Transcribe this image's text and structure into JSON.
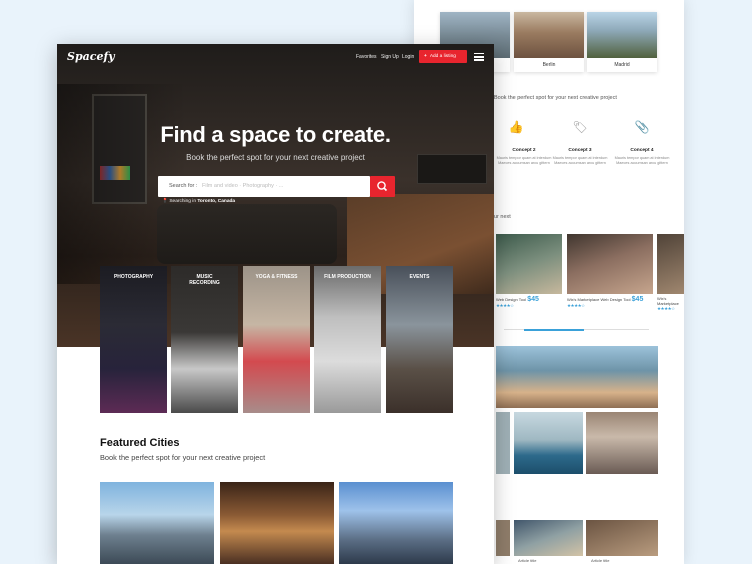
{
  "colors": {
    "accent": "#e8252e",
    "blue": "#3aa1d9",
    "bg": "#e9f3fb"
  },
  "back": {
    "cities": [
      {
        "label": ""
      },
      {
        "label": "Berlin"
      },
      {
        "label": "Madrid"
      }
    ],
    "tagline": "Book the perfect spot for your next creative project",
    "concepts": [
      {
        "icon": "thumbs-up-icon",
        "glyph": "👍",
        "title": "",
        "desc": ""
      },
      {
        "icon": "tag-icon",
        "glyph": "🏷",
        "title": "Concept 2",
        "desc": "Mauris tempor quam at interdum Maeces accumsan arcu gittern"
      },
      {
        "icon": "tag-icon",
        "glyph": "🏷",
        "title": "Concept 3",
        "desc": "Mauris tempor quam at interdum Maeces accumsan arcu gittern"
      },
      {
        "icon": "paperclip-icon",
        "glyph": "📎",
        "title": "Concept 4",
        "desc": "Mauris tempor quam at interdum Maeces accumsan arcu gittern"
      }
    ],
    "next_label": "ur next",
    "listings": [
      {
        "title": "Web Design Tool",
        "price": "$45",
        "unit": "BY DAY"
      },
      {
        "title": "Wix's Marketplace Web Design Tool",
        "price": "$45",
        "unit": "BY DAY"
      },
      {
        "title": "Wix's Marketplace",
        "price": "",
        "unit": ""
      }
    ],
    "rating": 4,
    "bottom_labels": [
      "Article title",
      "Article title"
    ]
  },
  "front": {
    "logo": "Spacefy",
    "nav": {
      "favorites": "Favorites",
      "signup": "Sign Up",
      "login": "Login",
      "add_listing": "Add a listing",
      "plus": "+"
    },
    "hero": {
      "title": "Find a space to create.",
      "subtitle": "Book the perfect spot for your next creative project",
      "search_prefix": "Search for :",
      "search_placeholder": "Film and video · Photography · ...",
      "location_prefix": "Searching in",
      "location": "Toronto, Canada"
    },
    "categories": [
      {
        "label": "PHOTOGRAPHY"
      },
      {
        "label": "MUSIC\nRECORDING"
      },
      {
        "label": "YOGA & FITNESS"
      },
      {
        "label": "FILM PRODUCTION"
      },
      {
        "label": "EVENTS"
      }
    ],
    "featured": {
      "title": "Featured Cities",
      "subtitle": "Book the perfect spot for your next creative project"
    }
  }
}
